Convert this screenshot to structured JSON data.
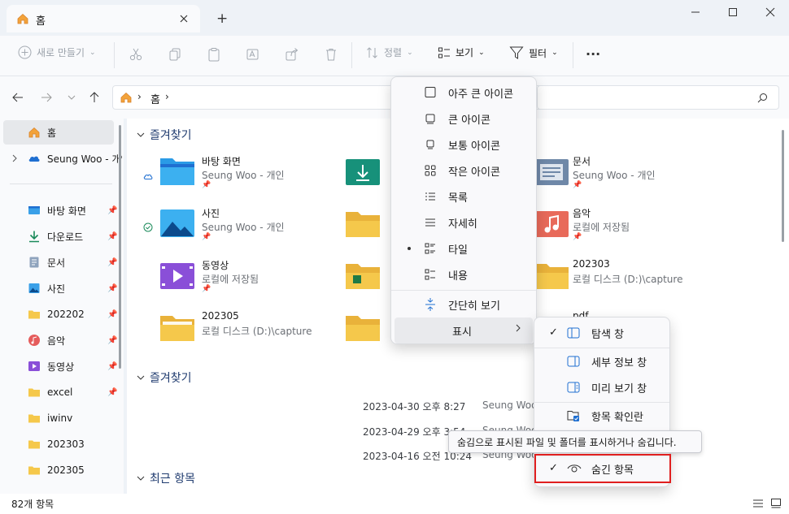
{
  "window": {
    "tab_title": "홈",
    "new_tab_symbol": "+",
    "close_symbol": "×"
  },
  "toolbar": {
    "new_label": "새로 만들기",
    "sort_label": "정렬",
    "view_label": "보기",
    "filter_label": "필터",
    "more_label": "···"
  },
  "address": {
    "crumb": "홈"
  },
  "sidebar": {
    "items": [
      {
        "label": "홈"
      },
      {
        "label": "Seung Woo - 개인"
      },
      {
        "label": "바탕 화면"
      },
      {
        "label": "다운로드"
      },
      {
        "label": "문서"
      },
      {
        "label": "사진"
      },
      {
        "label": "202202"
      },
      {
        "label": "음악"
      },
      {
        "label": "동영상"
      },
      {
        "label": "excel"
      },
      {
        "label": "iwinv"
      },
      {
        "label": "202303"
      },
      {
        "label": "202305"
      }
    ]
  },
  "main": {
    "section1": "즐겨찾기",
    "section2": "즐겨찾기",
    "section3": "최근 항목",
    "tiles": [
      {
        "title": "바탕 화면",
        "sub": "Seung Woo - 개인"
      },
      {
        "title": "사진",
        "sub": "Seung Woo - 개인"
      },
      {
        "title": "동영상",
        "sub": "로컬에 저장됨"
      },
      {
        "title": "202305",
        "sub": "로컬 디스크 (D:)\\capture"
      },
      {
        "title": "문서",
        "sub": "Seung Woo - 개인"
      },
      {
        "title": "음악",
        "sub": "로컬에 저장됨"
      },
      {
        "title": "202303",
        "sub": "로컬 디스크 (D:)\\capture"
      },
      {
        "title": "pdf",
        "sub": ""
      }
    ],
    "rows": [
      {
        "date": "2023-04-30 오후 8:27",
        "owner": "Seung Woo"
      },
      {
        "date": "2023-04-29 오후 3:54",
        "owner": "Seung Woo"
      },
      {
        "date": "2023-04-16 오전 10:24",
        "owner": "Seung Woo"
      }
    ]
  },
  "status": {
    "count": "82개 항목"
  },
  "view_menu": {
    "items": [
      {
        "label": "아주 큰 아이콘"
      },
      {
        "label": "큰 아이콘"
      },
      {
        "label": "보통 아이콘"
      },
      {
        "label": "작은 아이콘"
      },
      {
        "label": "목록"
      },
      {
        "label": "자세히"
      },
      {
        "label": "타일"
      },
      {
        "label": "내용"
      },
      {
        "label": "간단히 보기"
      },
      {
        "label": "표시"
      }
    ]
  },
  "show_menu": {
    "items": [
      {
        "label": "탐색 창"
      },
      {
        "label": "세부 정보 창"
      },
      {
        "label": "미리 보기 창"
      },
      {
        "label": "항목 확인란"
      },
      {
        "label": "숨긴 항목"
      }
    ],
    "check": "✓"
  },
  "tooltip": {
    "text": "숨김으로 표시된 파일 및 폴더를 표시하거나 숨깁니다."
  },
  "colors": {
    "accent": "#0067c0",
    "folder_yellow": "#f5c84b",
    "highlight_red": "#e01f1f"
  }
}
